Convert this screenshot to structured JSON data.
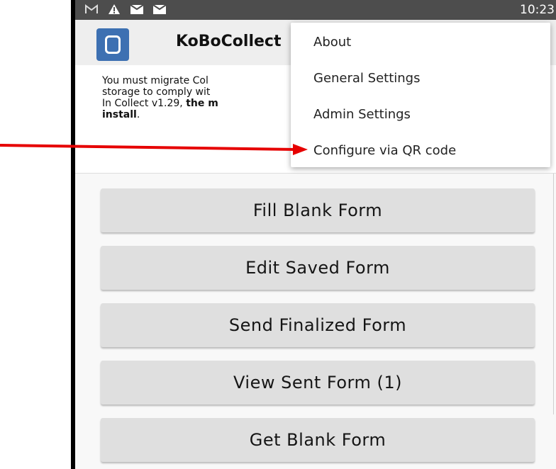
{
  "status_bar": {
    "time": "10:23",
    "icons": [
      "gmail-icon",
      "warning-icon",
      "message-icon",
      "message-icon"
    ]
  },
  "app_bar": {
    "title": "KoBoCollect"
  },
  "migration_notice": {
    "line1": "You must migrate Col",
    "line2": "storage to comply wit",
    "line3_prefix": "In Collect v1.29, ",
    "line3_bold": "the m",
    "line4_bold": "install",
    "line4_suffix": "."
  },
  "menu": {
    "items": [
      {
        "label": "About"
      },
      {
        "label": "General Settings"
      },
      {
        "label": "Admin Settings"
      },
      {
        "label": "Configure via QR code"
      }
    ]
  },
  "main_buttons": [
    {
      "label": "Fill Blank Form"
    },
    {
      "label": "Edit Saved Form"
    },
    {
      "label": "Send Finalized Form"
    },
    {
      "label": "View Sent Form (1)"
    },
    {
      "label": "Get Blank Form"
    }
  ],
  "colors": {
    "status_bar": "#4d4d4d",
    "app_bar": "#eeeeee",
    "app_icon": "#3d70b2",
    "button": "#dfdfdf",
    "annotation_arrow": "#e60000"
  }
}
